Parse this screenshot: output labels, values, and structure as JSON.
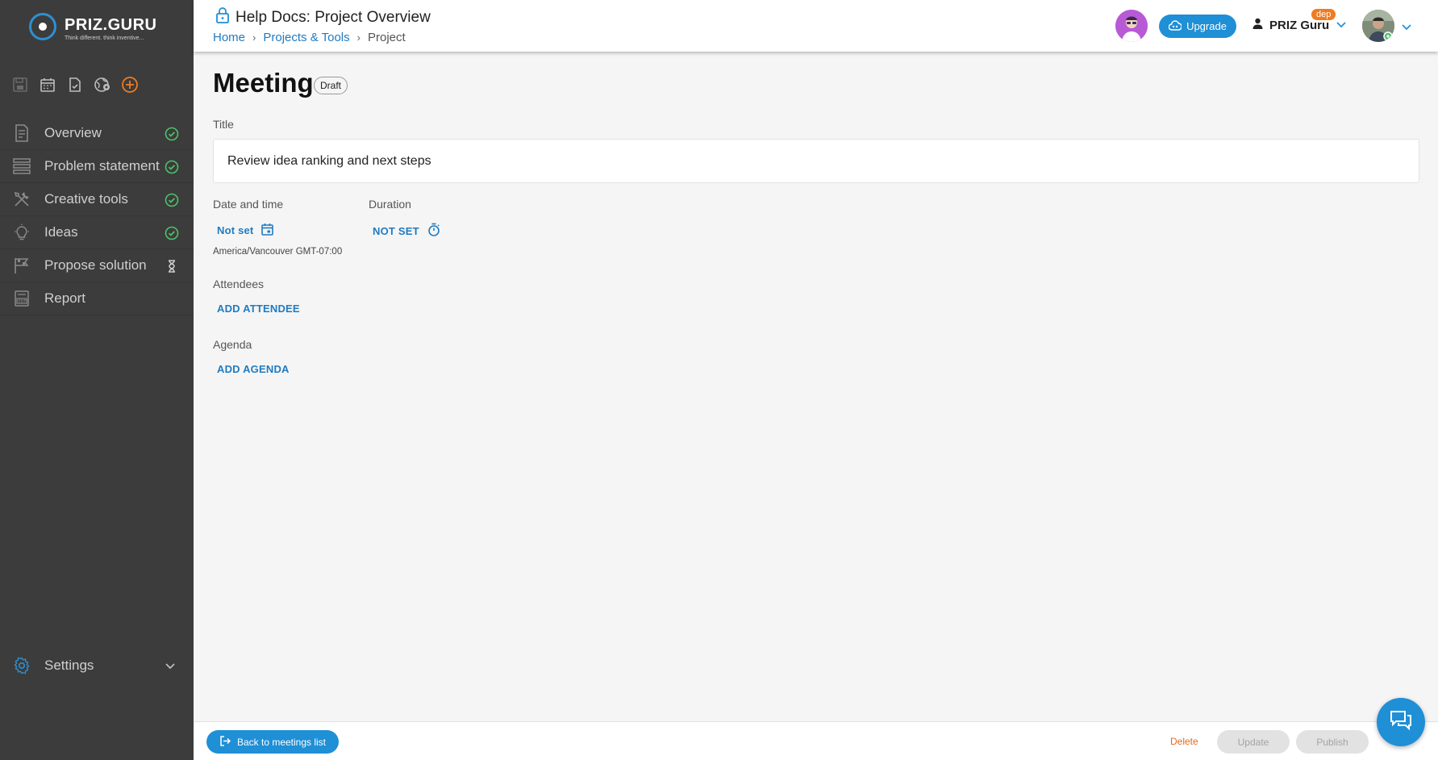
{
  "app": {
    "logo_text": "PRIZ.GURU",
    "logo_tagline": "Think different. think inventive..."
  },
  "sidebar": {
    "quick_icons": [
      "save-icon",
      "calendar-icon",
      "document-check-icon",
      "globe-settings-icon",
      "add-circle-icon"
    ],
    "items": [
      {
        "label": "Overview",
        "icon": "document-list-icon",
        "status": "complete"
      },
      {
        "label": "Problem statement",
        "icon": "stack-icon",
        "status": "complete"
      },
      {
        "label": "Creative tools",
        "icon": "tools-icon",
        "status": "complete"
      },
      {
        "label": "Ideas",
        "icon": "lightbulb-icon",
        "status": "complete"
      },
      {
        "label": "Propose solution",
        "icon": "flag-icon",
        "status": "pending"
      },
      {
        "label": "Report",
        "icon": "pdf-report-icon",
        "status": "none"
      }
    ],
    "settings_label": "Settings"
  },
  "header": {
    "title": "Help Docs: Project Overview",
    "breadcrumbs": [
      "Home",
      "Projects & Tools",
      "Project"
    ],
    "upgrade_label": "Upgrade",
    "workspace_name": "PRIZ Guru",
    "workspace_badge": "dep"
  },
  "main": {
    "page_title": "Meeting",
    "status_badge": "Draft",
    "title_label": "Title",
    "title_value": "Review idea ranking and next steps",
    "datetime_label": "Date and time",
    "datetime_value": "Not set",
    "timezone": "America/Vancouver GMT-07:00",
    "duration_label": "Duration",
    "duration_value": "NOT SET",
    "attendees_label": "Attendees",
    "add_attendee": "ADD ATTENDEE",
    "agenda_label": "Agenda",
    "add_agenda": "ADD AGENDA"
  },
  "footer": {
    "back_label": "Back to meetings list",
    "delete_label": "Delete",
    "update_label": "Update",
    "publish_label": "Publish"
  },
  "colors": {
    "accent": "#1f8fd6",
    "sidebar_bg": "#3c3c3c",
    "success": "#4cc36a",
    "danger": "#e06a1f"
  }
}
